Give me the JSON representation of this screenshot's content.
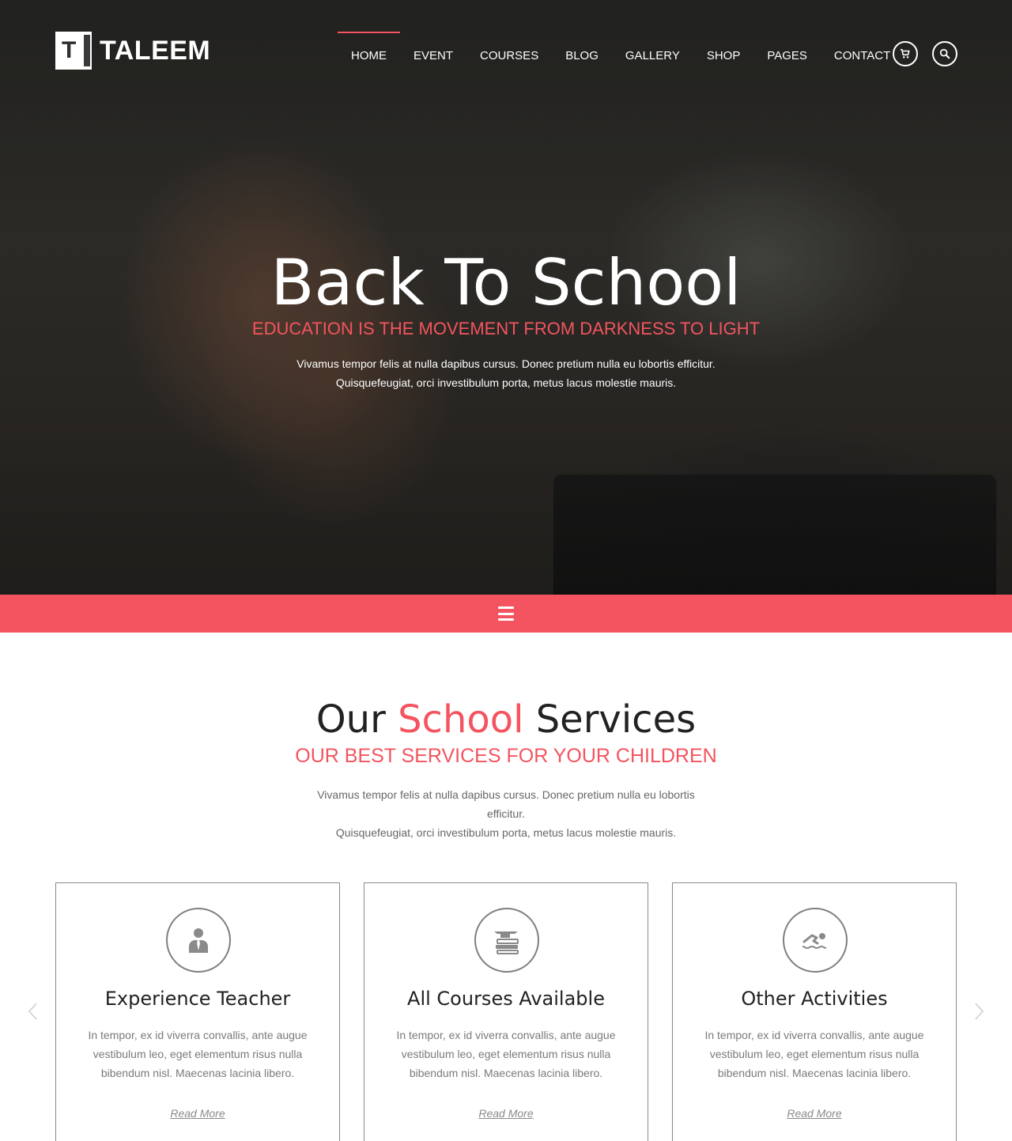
{
  "brand": {
    "logo_letter": "T",
    "name": "TALEEM"
  },
  "nav": {
    "items": [
      "HOME",
      "EVENT",
      "COURSES",
      "BLOG",
      "GALLERY",
      "SHOP",
      "PAGES",
      "CONTACT"
    ],
    "active": "HOME"
  },
  "header_icons": {
    "cart": "cart-icon",
    "search": "search-icon"
  },
  "hero": {
    "title": "Back To School",
    "subtitle": "EDUCATION IS THE MOVEMENT FROM DARKNESS TO LIGHT",
    "desc_line1": "Vivamus tempor felis at nulla dapibus cursus. Donec pretium nulla eu lobortis efficitur.",
    "desc_line2": "Quisquefeugiat, orci investibulum porta, metus lacus molestie mauris."
  },
  "menu_bar": {
    "icon": "hamburger-menu-icon"
  },
  "services": {
    "title_before": "Our ",
    "title_accent": "School",
    "title_after": " Services",
    "subtitle": "OUR BEST SERVICES FOR YOUR CHILDREN",
    "desc_line1": "Vivamus tempor felis at nulla dapibus cursus. Donec pretium nulla eu lobortis",
    "desc_line2": "efficitur.",
    "desc_line3": "Quisquefeugiat, orci investibulum porta, metus lacus molestie mauris.",
    "cards": [
      {
        "icon": "teacher-icon",
        "title": "Experience Teacher",
        "text_line1": "In tempor, ex id viverra convallis, ante augue",
        "text_line2": "vestibulum leo, eget elementum risus nulla",
        "text_line3": "bibendum nisl. Maecenas lacinia libero.",
        "link": "Read More"
      },
      {
        "icon": "courses-icon",
        "title": "All Courses Available",
        "text_line1": "In tempor, ex id viverra convallis, ante augue",
        "text_line2": "vestibulum leo, eget elementum risus nulla",
        "text_line3": "bibendum nisl. Maecenas lacinia libero.",
        "link": "Read More"
      },
      {
        "icon": "swimmer-icon",
        "title": "Other Activities",
        "text_line1": "In tempor, ex id viverra convallis, ante augue",
        "text_line2": "vestibulum leo, eget elementum risus nulla",
        "text_line3": "bibendum nisl. Maecenas lacinia libero.",
        "link": "Read More"
      }
    ]
  },
  "colors": {
    "accent": "#f4545f",
    "text_dark": "#222222",
    "text_muted": "#7a7a7a"
  }
}
